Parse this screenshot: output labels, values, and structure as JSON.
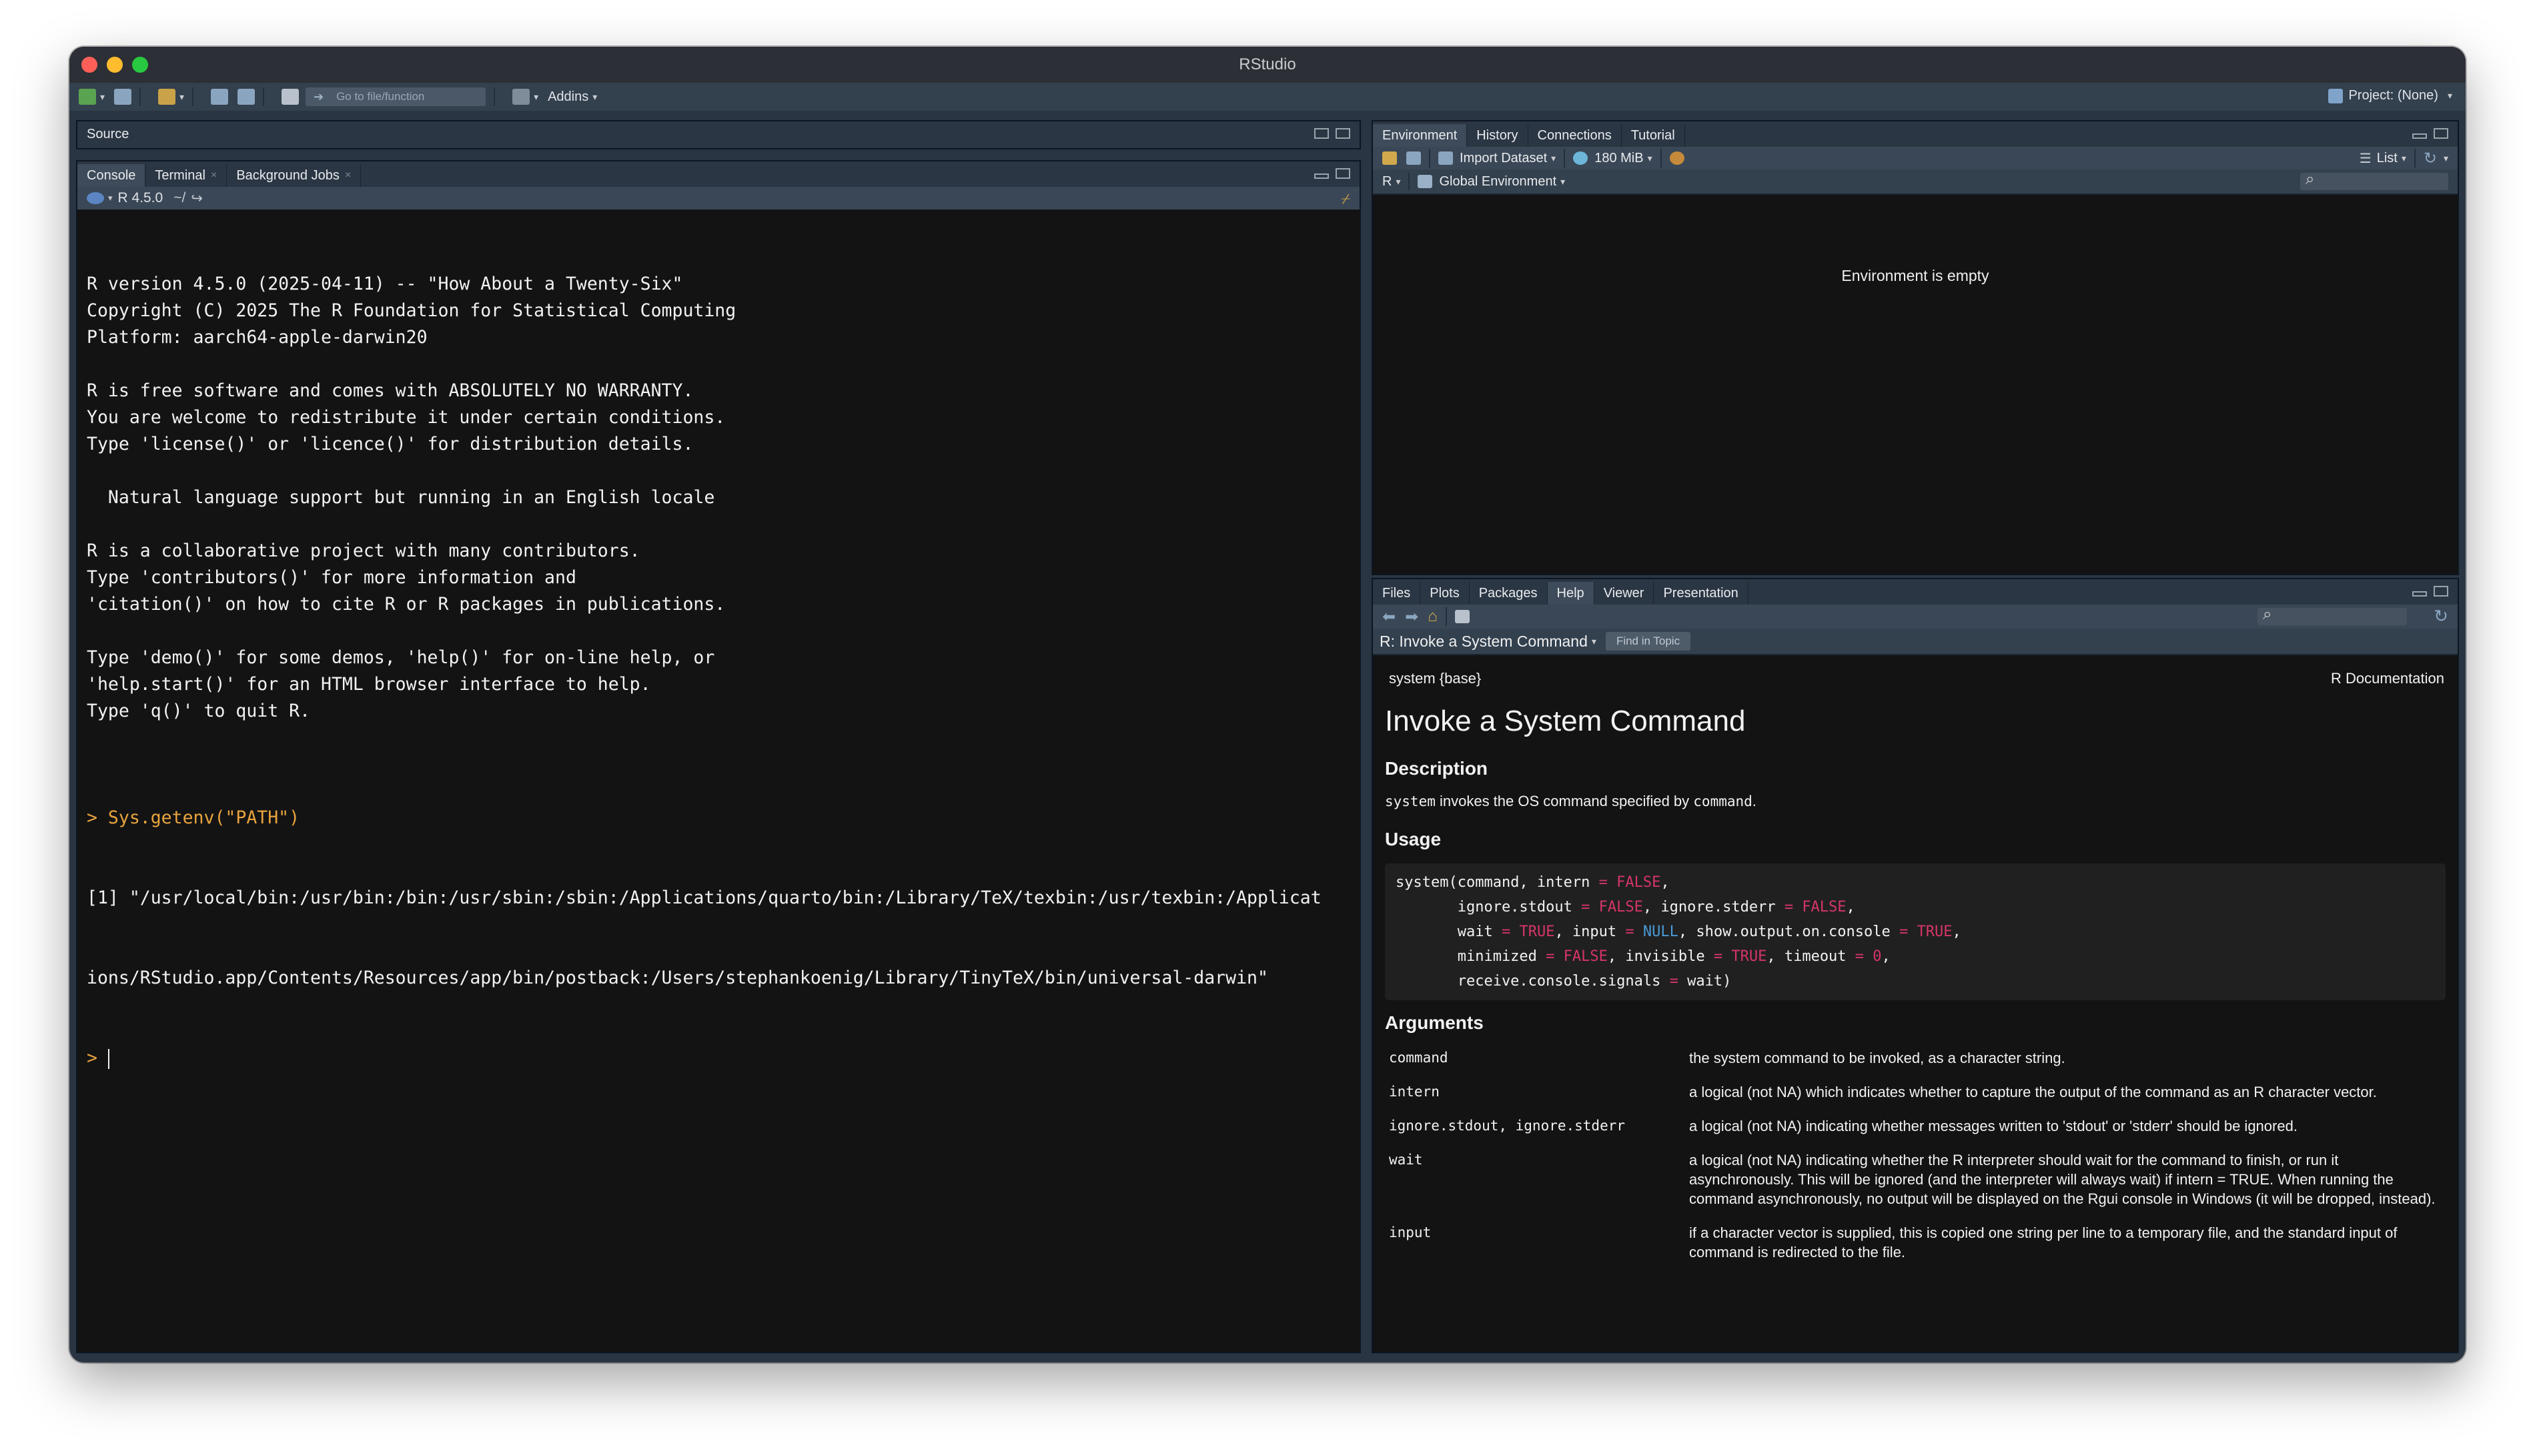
{
  "window": {
    "title": "RStudio"
  },
  "toolbar": {
    "goto_placeholder": "Go to file/function",
    "addins_label": "Addins",
    "project_label": "Project: (None)"
  },
  "source": {
    "label": "Source"
  },
  "console": {
    "tabs": [
      {
        "label": "Console"
      },
      {
        "label": "Terminal"
      },
      {
        "label": "Background Jobs"
      }
    ],
    "r_version": "R 4.5.0",
    "path": "~/",
    "lines": [
      "R version 4.5.0 (2025-04-11) -- \"How About a Twenty-Six\"",
      "Copyright (C) 2025 The R Foundation for Statistical Computing",
      "Platform: aarch64-apple-darwin20",
      "",
      "R is free software and comes with ABSOLUTELY NO WARRANTY.",
      "You are welcome to redistribute it under certain conditions.",
      "Type 'license()' or 'licence()' for distribution details.",
      "",
      "  Natural language support but running in an English locale",
      "",
      "R is a collaborative project with many contributors.",
      "Type 'contributors()' for more information and",
      "'citation()' on how to cite R or R packages in publications.",
      "",
      "Type 'demo()' for some demos, 'help()' for on-line help, or",
      "'help.start()' for an HTML browser interface to help.",
      "Type 'q()' to quit R.",
      ""
    ],
    "command": "> Sys.getenv(\"PATH\")",
    "output_1": "[1] \"/usr/local/bin:/usr/bin:/bin:/usr/sbin:/sbin:/Applications/quarto/bin:/Library/TeX/texbin:/usr/texbin:/Applicat",
    "output_2": "ions/RStudio.app/Contents/Resources/app/bin/postback:/Users/stephankoenig/Library/TinyTeX/bin/universal-darwin\"",
    "prompt": "> "
  },
  "environment": {
    "tabs": [
      {
        "label": "Environment"
      },
      {
        "label": "History"
      },
      {
        "label": "Connections"
      },
      {
        "label": "Tutorial"
      }
    ],
    "import_label": "Import Dataset",
    "memory_label": "180 MiB",
    "list_label": "List",
    "lang_label": "R",
    "scope_label": "Global Environment",
    "empty_message": "Environment is empty"
  },
  "help": {
    "tabs": [
      {
        "label": "Files"
      },
      {
        "label": "Plots"
      },
      {
        "label": "Packages"
      },
      {
        "label": "Help"
      },
      {
        "label": "Viewer"
      },
      {
        "label": "Presentation"
      }
    ],
    "topic_label": "R: Invoke a System Command",
    "find_label": "Find in Topic",
    "pkg": "system {base}",
    "doc_label": "R Documentation",
    "title": "Invoke a System Command",
    "h_description": "Description",
    "desc_code1": "system",
    "desc_text": " invokes the OS command specified by ",
    "desc_code2": "command",
    "desc_end": ".",
    "h_usage": "Usage",
    "h_arguments": "Arguments",
    "arguments": [
      {
        "name": "command",
        "desc": "the system command to be invoked, as a character string."
      },
      {
        "name": "intern",
        "desc": "a logical (not NA) which indicates whether to capture the output of the command as an R character vector."
      },
      {
        "name": "ignore.stdout, ignore.stderr",
        "desc": "a logical (not NA) indicating whether messages written to 'stdout' or 'stderr' should be ignored."
      },
      {
        "name": "wait",
        "desc": "a logical (not NA) indicating whether the R interpreter should wait for the command to finish, or run it asynchronously. This will be ignored (and the interpreter will always wait) if intern = TRUE. When running the command asynchronously, no output will be displayed on the Rgui console in Windows (it will be dropped, instead)."
      },
      {
        "name": "input",
        "desc": "if a character vector is supplied, this is copied one string per line to a temporary file, and the standard input of command is redirected to the file."
      }
    ]
  }
}
